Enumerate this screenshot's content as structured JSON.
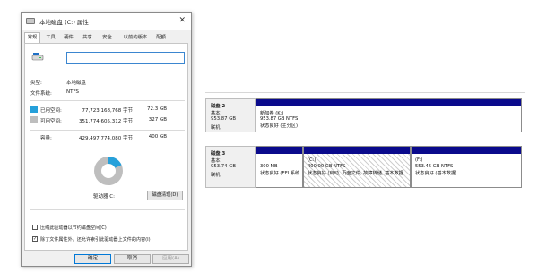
{
  "dialog": {
    "title": "本地磁盘 (C:) 属性",
    "close_glyph": "✕",
    "tabs": [
      "常规",
      "工具",
      "硬件",
      "共享",
      "安全",
      "以前的版本",
      "配额"
    ],
    "drive_name_value": "",
    "type_label": "类型:",
    "type_value": "本地磁盘",
    "fs_label": "文件系统:",
    "fs_value": "NTFS",
    "used": {
      "label": "已用空间:",
      "bytes": "77,723,168,768 字节",
      "size": "72.3 GB",
      "color": "#26a0da"
    },
    "free": {
      "label": "可用空间:",
      "bytes": "351,774,605,312 字节",
      "size": "327 GB",
      "color": "#bebebe"
    },
    "capacity": {
      "label": "容量:",
      "bytes": "429,497,774,080 字节",
      "size": "400 GB"
    },
    "used_fraction": 0.18,
    "drive_letter_label": "驱动器 C:",
    "cleanup_button": "磁盘清理(D)",
    "compress_label": "压缩此驱动器以节约磁盘空间(C)",
    "compress_checked": "",
    "index_label": "除了文件属性外，还允许索引此驱动器上文件的内容(I)",
    "index_checked": "✓",
    "ok_button": "确定",
    "cancel_button": "取消",
    "apply_button": "应用(A)"
  },
  "disk_management": {
    "bar_color": "#0a0a8c",
    "disks": [
      {
        "name": "磁盘 2",
        "type": "基本",
        "size": "953.87 GB",
        "status": "联机",
        "partitions": [
          {
            "title": "新加卷  (K:)",
            "line1": "953.87 GB NTFS",
            "line2": "状态良好 (主分区)"
          }
        ]
      },
      {
        "name": "磁盘 3",
        "type": "基本",
        "size": "953.74 GB",
        "status": "联机",
        "partitions": [
          {
            "title": "",
            "line1": "300 MB",
            "line2": "状态良好 (EFI 系统"
          },
          {
            "title": "(C:)",
            "line1": "400.00 GB NTFS",
            "line2": "状态良好 (启动, 页面文件, 故障转储, 基本数据"
          },
          {
            "title": "(F:)",
            "line1": "553.45 GB NTFS",
            "line2": "状态良好 (基本数据"
          }
        ]
      }
    ]
  }
}
